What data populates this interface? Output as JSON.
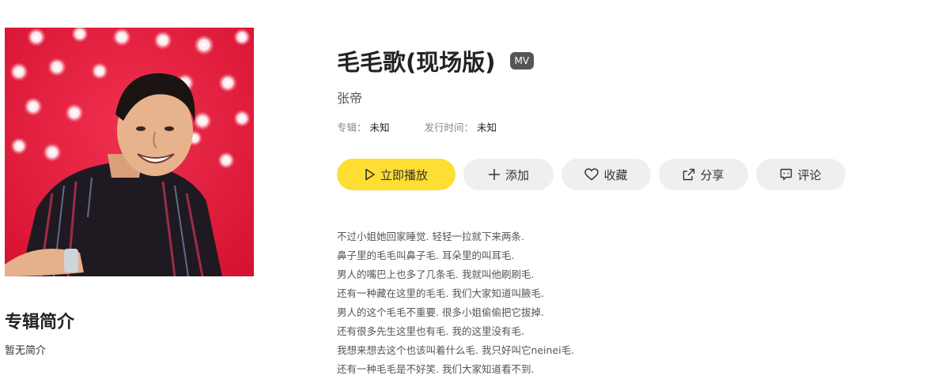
{
  "song": {
    "title": "毛毛歌(现场版)",
    "mv_badge": "MV",
    "singer": "张帝",
    "album_label": "专辑：",
    "album_value": "未知",
    "release_label": "发行时间：",
    "release_value": "未知"
  },
  "actions": {
    "play": "立即播放",
    "add": "添加",
    "favorite": "收藏",
    "share": "分享",
    "comment": "评论"
  },
  "album_intro": {
    "title": "专辑简介",
    "text": "暂无简介"
  },
  "lyrics": [
    "不过小姐她回家睡觉. 轻轻一拉就下来两条.",
    "鼻子里的毛毛叫鼻子毛. 耳朵里的叫耳毛.",
    "男人的嘴巴上也多了几条毛. 我就叫他刷刷毛.",
    "还有一种藏在这里的毛毛. 我们大家知道叫腋毛.",
    "男人的这个毛毛不重要. 很多小姐偷偷把它拔掉.",
    "还有很多先生这里也有毛. 我的这里没有毛.",
    "我想来想去这个也该叫着什么毛. 我只好叫它neinei毛.",
    "还有一种毛毛是不好笑. 我们大家知道看不到."
  ],
  "colors": {
    "play_button": "#ffde34",
    "button_bg": "#efefef",
    "cover_bg": "#e5173a"
  },
  "icons": {
    "play": "play-icon",
    "add": "plus-icon",
    "favorite": "heart-icon",
    "share": "share-icon",
    "comment": "comment-icon"
  }
}
